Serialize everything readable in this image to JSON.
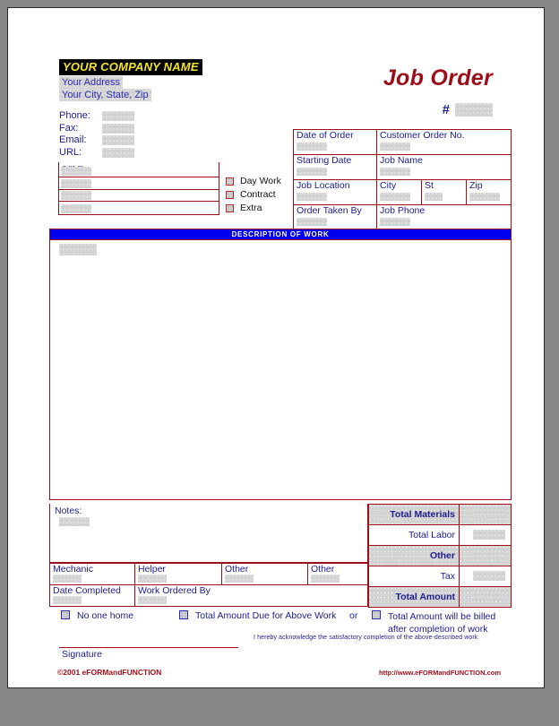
{
  "header": {
    "company_name": "YOUR COMPANY NAME",
    "address_line": "Your Address",
    "city_state_zip": "Your City, State, Zip",
    "contact_labels": [
      "Phone:",
      "Fax:",
      "Email:",
      "URL:"
    ],
    "title": "Job Order",
    "number_symbol": "#"
  },
  "bill_to": {
    "label": "Bill To:"
  },
  "work_type": {
    "options": [
      "Day Work",
      "Contract",
      "Extra"
    ]
  },
  "order_details": {
    "date_of_order": "Date of Order",
    "customer_order_no": "Customer Order No.",
    "starting_date": "Starting Date",
    "job_name": "Job Name",
    "job_location": "Job Location",
    "city": "City",
    "state": "St",
    "zip": "Zip",
    "order_taken_by": "Order Taken By",
    "job_phone": "Job Phone"
  },
  "description": {
    "banner": "DESCRIPTION OF WORK"
  },
  "notes": {
    "label": "Notes:"
  },
  "totals": {
    "rows": [
      {
        "label": "Total Materials",
        "emphasis": true
      },
      {
        "label": "Total Labor",
        "emphasis": false
      },
      {
        "label": "Other",
        "emphasis": true
      },
      {
        "label": "Tax",
        "emphasis": false
      },
      {
        "label": "Total Amount",
        "emphasis": true
      }
    ]
  },
  "crew": {
    "mechanic": "Mechanic",
    "helper": "Helper",
    "other1": "Other",
    "other2": "Other",
    "date_completed": "Date Completed",
    "work_ordered_by": "Work Ordered By"
  },
  "footer": {
    "no_one_home": "No one home",
    "amount_due": "Total Amount Due for Above Work",
    "or": "or",
    "billed_line1": "Total Amount will be billed",
    "billed_line2": "after completion of work",
    "acknowledgement": "I hereby acknowledge the satisfactory completion of the above-described work",
    "signature": "Signature",
    "copyright": "©2001 eFORMandFUNCTION",
    "website": "http://www.eFORMandFUNCTION.com"
  },
  "colors": {
    "accent_red": "#9b0d18",
    "banner_blue": "#0000ee",
    "label_blue": "#1c1c8c",
    "company_yellow": "#f2e42a"
  }
}
